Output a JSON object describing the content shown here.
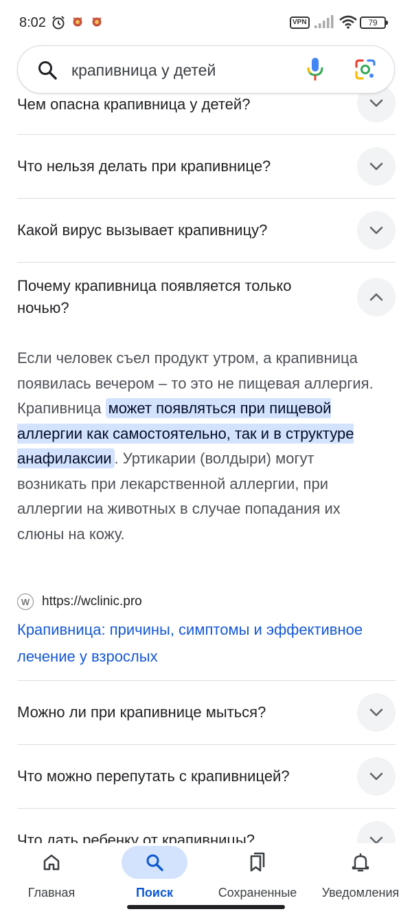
{
  "status_bar": {
    "time": "8:02",
    "vpn_label": "VPN",
    "battery_level": "79"
  },
  "search": {
    "query": "крапивница у детей"
  },
  "faq": {
    "items": [
      {
        "question": "Чем опасна крапивница у детей?",
        "expanded": false
      },
      {
        "question": "Что нельзя делать при крапивнице?",
        "expanded": false
      },
      {
        "question": "Какой вирус вызывает крапивницу?",
        "expanded": false
      },
      {
        "question": "Почему крапивница появляется только ночью?",
        "expanded": true
      },
      {
        "question": "Можно ли при крапивнице мыться?",
        "expanded": false
      },
      {
        "question": "Что можно перепутать с крапивницей?",
        "expanded": false
      },
      {
        "question": "Что дать ребенку от крапивницы?",
        "expanded": false
      }
    ],
    "answer": {
      "text_before": "Если человек съел продукт утром, а крапивница появилась вечером – то это не пищевая аллергия. Крапивница ",
      "highlight": "может появляться при пищевой аллергии как самостоятельно, так и в структуре анафилаксии",
      "text_after": ". Уртикарии (волдыри) могут возникать при лекарственной аллергии, при аллергии на животных в случае попадания их слюны на кожу."
    },
    "source": {
      "favicon_letter": "W",
      "url": "https://wclinic.pro",
      "title": "Крапивница: причины, симптомы и эффективное лечение у взрослых"
    }
  },
  "bottom_nav": {
    "items": [
      {
        "label": "Главная",
        "icon": "home-icon",
        "active": false
      },
      {
        "label": "Поиск",
        "icon": "search-icon",
        "active": true
      },
      {
        "label": "Сохраненные",
        "icon": "bookmarks-icon",
        "active": false
      },
      {
        "label": "Уведомления",
        "icon": "bell-icon",
        "active": false
      }
    ]
  },
  "colors": {
    "accent": "#0b57d0",
    "highlight_bg": "#d3e3fd",
    "link": "#1558d6",
    "chevron_bg": "#f1f3f4"
  }
}
